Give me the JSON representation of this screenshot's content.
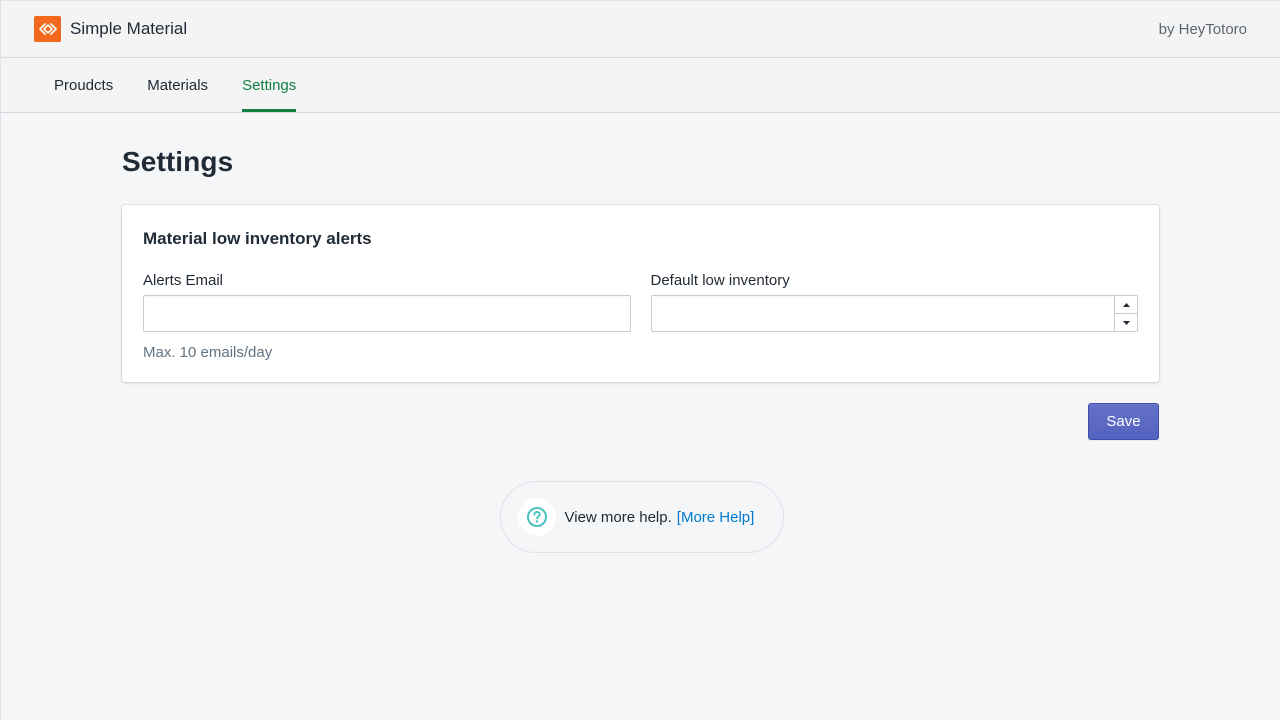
{
  "header": {
    "app_name": "Simple Material",
    "byline": "by HeyTotoro",
    "logo_color": "#f2691d"
  },
  "tabs": [
    {
      "label": "Proudcts",
      "active": false
    },
    {
      "label": "Materials",
      "active": false
    },
    {
      "label": "Settings",
      "active": true
    }
  ],
  "page": {
    "title": "Settings"
  },
  "card": {
    "title": "Material low inventory alerts",
    "alerts_email": {
      "label": "Alerts Email",
      "value": "",
      "placeholder": "",
      "help_text": "Max. 10 emails/day"
    },
    "default_low_inventory": {
      "label": "Default low inventory",
      "value": "",
      "placeholder": ""
    }
  },
  "actions": {
    "save_label": "Save"
  },
  "help": {
    "message": "View more help.",
    "link_text": "[More Help]",
    "icon": "question-circle-icon"
  },
  "colors": {
    "active_tab": "#108043",
    "primary_button": "#5c6ac4",
    "link": "#007ace",
    "help_icon": "#47c1bf"
  }
}
